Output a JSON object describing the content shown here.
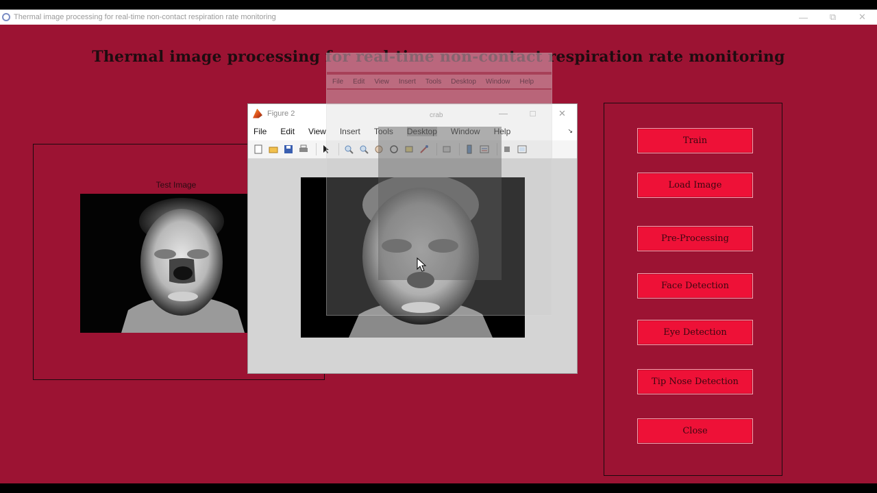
{
  "window": {
    "title": "Thermal image processing for real-time non-contact respiration rate monitoring",
    "controls": [
      "minimize",
      "restore",
      "close"
    ]
  },
  "app": {
    "heading": "Thermal image processing for real-time non-contact respiration rate monitoring",
    "test_panel": {
      "caption": "Test Image"
    },
    "buttons": [
      {
        "label": "Train"
      },
      {
        "label": "Load Image"
      },
      {
        "label": "Pre-Processing"
      },
      {
        "label": "Face Detection"
      },
      {
        "label": "Eye Detection"
      },
      {
        "label": "Tip Nose Detection"
      },
      {
        "label": "Close"
      }
    ]
  },
  "figure": {
    "title": "Figure 2",
    "menu": [
      "File",
      "Edit",
      "View",
      "Insert",
      "Tools",
      "Desktop",
      "Window",
      "Help"
    ],
    "highlighted_menu": "Desktop",
    "toolbar_icons": [
      "new-figure-icon",
      "open-icon",
      "save-icon",
      "print-icon",
      "pointer-icon",
      "zoom-in-icon",
      "zoom-out-icon",
      "pan-icon",
      "rotate-icon",
      "data-cursor-icon",
      "brush-icon",
      "link-icon",
      "colorbar-icon",
      "legend-icon",
      "hide-plot-tools-icon",
      "show-plot-tools-icon"
    ]
  },
  "ghost_window": {
    "label": "crab",
    "menu": [
      "File",
      "Edit",
      "View",
      "Insert",
      "Tools",
      "Desktop",
      "Window",
      "Help"
    ]
  },
  "colors": {
    "background": "#9c1333",
    "button": "#ee1137",
    "heading": "#1e0c10"
  }
}
